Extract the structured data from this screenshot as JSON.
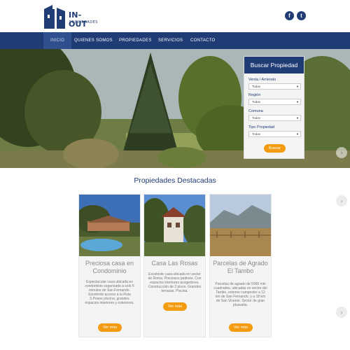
{
  "logo": {
    "title": "IN-OUT",
    "subtitle": "PROPIEDADES"
  },
  "social": {
    "facebook_glyph": "f",
    "twitter_glyph": "t"
  },
  "nav": {
    "items": [
      {
        "label": "INICIO",
        "active": true
      },
      {
        "label": "QUIENES SOMOS",
        "active": false
      },
      {
        "label": "PROPIEDADES",
        "active": false
      },
      {
        "label": "SERVICIOS",
        "active": false
      },
      {
        "label": "CONTACTO",
        "active": false
      }
    ]
  },
  "search": {
    "title": "Buscar Propiedad",
    "fields": [
      {
        "label": "Venta / Arriendo",
        "value": "Todas"
      },
      {
        "label": "Región",
        "value": "Todas"
      },
      {
        "label": "Comuna",
        "value": "Todas"
      },
      {
        "label": "Tipo Propiedad",
        "value": "Todas"
      }
    ],
    "button": "Buscar"
  },
  "featured": {
    "title": "Propiedades Destacadas",
    "cards": [
      {
        "title": "Preciosa casa en Condominio",
        "description": "Espectacular casa ubicada en condominio segurizado a solo 5 minutos de San Fernando. Excelente acceso a la Ruta 5.Posee piscina, grandes espacios interiores y exteriores.",
        "button": "Ver más"
      },
      {
        "title": "Casa Las Rosas",
        "description": "Excelente casa ubicada en sector de Roma. Preciosos jardines. Con espacios interiores acogedores. Construcción de 2 pisos. Grandes terrazas. Piscina.",
        "button": "Ver más"
      },
      {
        "title": "Parcelas de Agrado El Tambo",
        "description": "Parcelas de agrado de 5000 mts cuadrados, ubicadas en sector del Tambo, entorno campestre a 12 km de San Fernando, y a 18 km de San Vicente. Sector de gran plusvalía.",
        "button": "Ver más"
      }
    ]
  },
  "icons": {
    "hero_next": "chevron-right-icon",
    "carousel_prev": "chevron-right-icon",
    "carousel_next": "chevron-right-icon"
  },
  "colors": {
    "brand": "#1f3c75",
    "accent": "#f39c12"
  }
}
